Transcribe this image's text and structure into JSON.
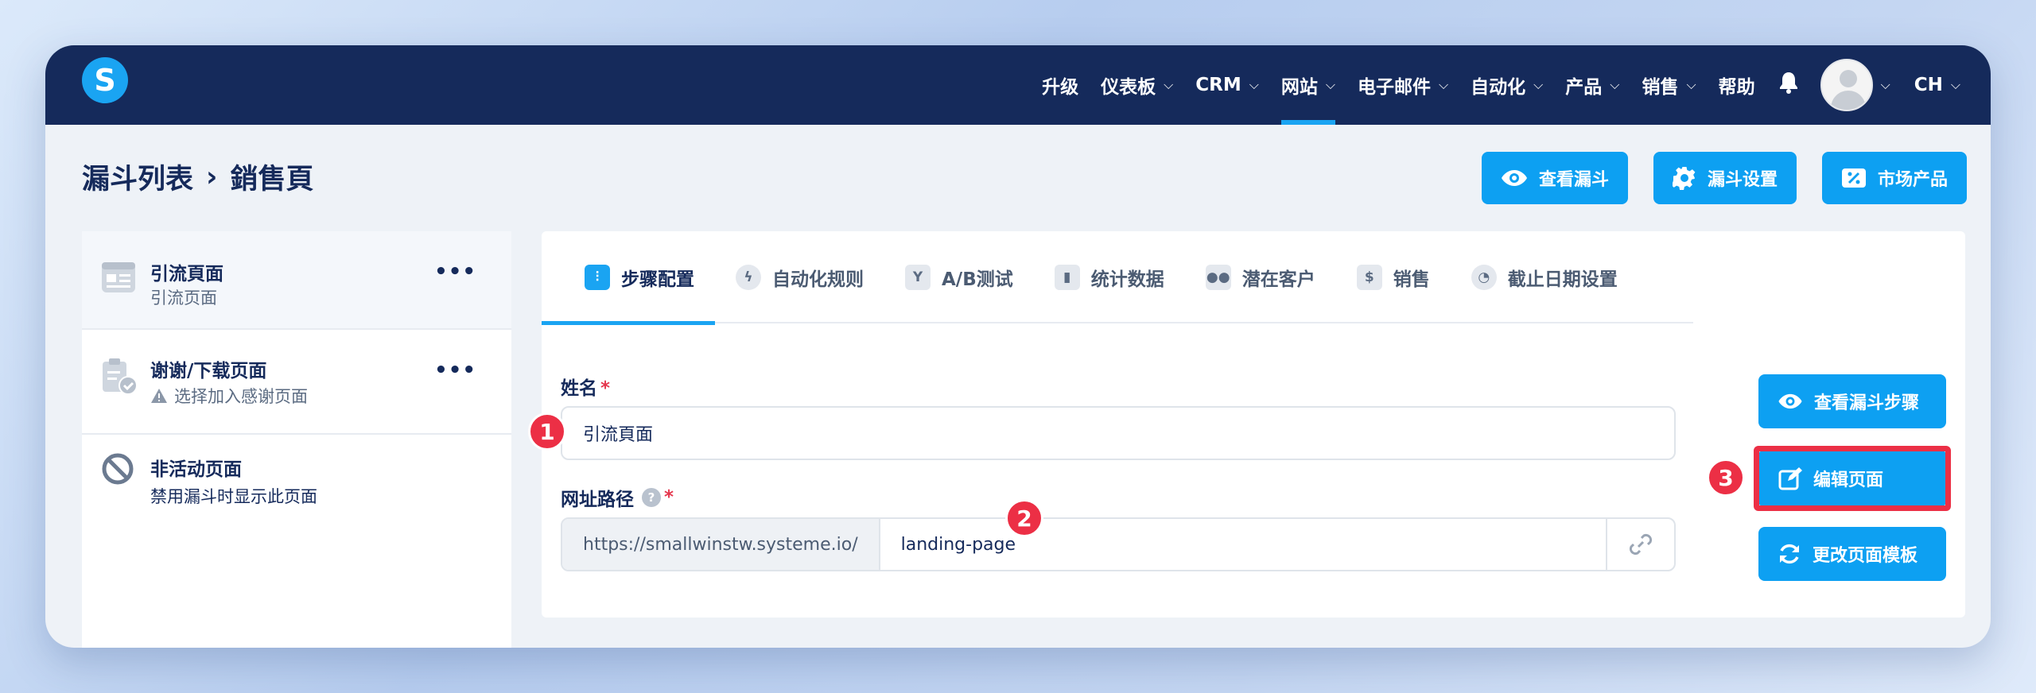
{
  "nav": {
    "logo": "S",
    "items": [
      {
        "label": "升级",
        "chevron": false
      },
      {
        "label": "仪表板",
        "chevron": true
      },
      {
        "label": "CRM",
        "chevron": true
      },
      {
        "label": "网站",
        "chevron": true,
        "active": true
      },
      {
        "label": "电子邮件",
        "chevron": true
      },
      {
        "label": "自动化",
        "chevron": true
      },
      {
        "label": "产品",
        "chevron": true
      },
      {
        "label": "销售",
        "chevron": true
      },
      {
        "label": "帮助",
        "chevron": false
      }
    ],
    "language": "CH"
  },
  "breadcrumb": {
    "parent": "漏斗列表",
    "separator": "›",
    "current": "銷售頁"
  },
  "header_buttons": {
    "view_funnel": "查看漏斗",
    "funnel_settings": "漏斗设置",
    "market_product": "市场产品"
  },
  "sidebar": {
    "items": [
      {
        "title": "引流頁面",
        "subtitle": "引流页面"
      },
      {
        "title": "谢谢/下载页面",
        "subtitle": "选择加入感谢页面",
        "warning": true
      },
      {
        "title": "非活动页面",
        "subtitle": "禁用漏斗时显示此页面"
      }
    ],
    "more": "•••"
  },
  "tabs": [
    {
      "label": "步骤配置",
      "active": true
    },
    {
      "label": "自动化规则"
    },
    {
      "label": "A/B测试"
    },
    {
      "label": "统计数据"
    },
    {
      "label": "潜在客户"
    },
    {
      "label": "销售"
    },
    {
      "label": "截止日期设置"
    }
  ],
  "form": {
    "name_label": "姓名",
    "required": "*",
    "name_value": "引流頁面",
    "url_label": "网址路径",
    "help": "?",
    "url_prefix": "https://smallwinstw.systeme.io/",
    "url_value": "landing-page"
  },
  "side_buttons": {
    "view_steps": "查看漏斗步骤",
    "edit_page": "编辑页面",
    "change_template": "更改页面模板"
  },
  "badges": [
    "1",
    "2",
    "3"
  ],
  "colors": {
    "nav": "#152a5b",
    "accent": "#0da0f2",
    "badge": "#ec2f45"
  }
}
